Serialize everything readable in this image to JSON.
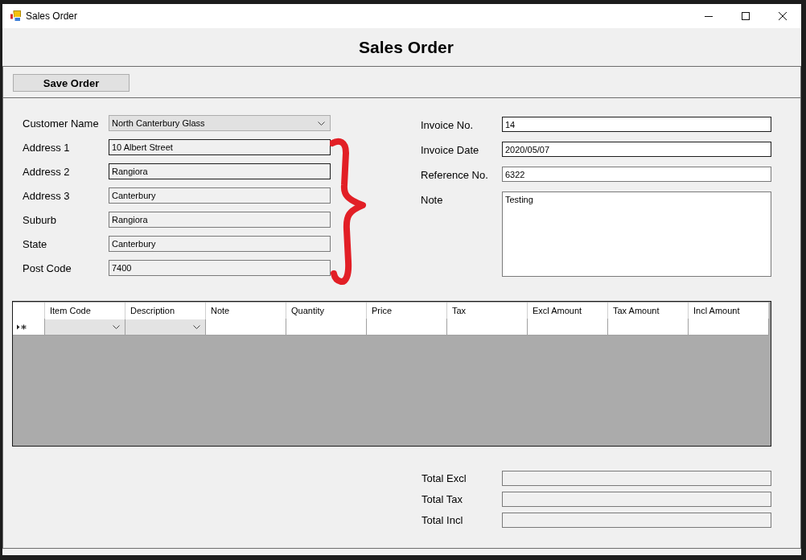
{
  "window": {
    "title": "Sales Order"
  },
  "heading": "Sales Order",
  "toolbar": {
    "buttons": [
      {
        "label": "Save Order"
      }
    ]
  },
  "customer": {
    "fields": [
      {
        "label": "Customer Name",
        "kind": "dropdown",
        "value": "North Canterbury Glass",
        "outlined": false,
        "readonly": true
      },
      {
        "label": "Address 1",
        "kind": "text",
        "value": "10 Albert Street",
        "outlined": true,
        "readonly": true
      },
      {
        "label": "Address 2",
        "kind": "text",
        "value": "Rangiora",
        "outlined": true,
        "readonly": true
      },
      {
        "label": "Address 3",
        "kind": "text",
        "value": "Canterbury",
        "outlined": false,
        "readonly": true
      },
      {
        "label": "Suburb",
        "kind": "text",
        "value": "Rangiora",
        "outlined": false,
        "readonly": true
      },
      {
        "label": "State",
        "kind": "text",
        "value": "Canterbury",
        "outlined": false,
        "readonly": true
      },
      {
        "label": "Post Code",
        "kind": "text",
        "value": "7400",
        "outlined": false,
        "readonly": true
      }
    ]
  },
  "invoice": {
    "fields": [
      {
        "label": "Invoice No.",
        "kind": "text",
        "value": "14",
        "outlined": true,
        "readonly": false
      },
      {
        "label": "Invoice Date",
        "kind": "text",
        "value": "2020/05/07",
        "outlined": true,
        "readonly": false
      },
      {
        "label": "Reference No.",
        "kind": "text",
        "value": "6322",
        "outlined": false,
        "readonly": false
      },
      {
        "label": "Note",
        "kind": "multiline",
        "value": "Testing",
        "outlined": false,
        "readonly": false
      }
    ]
  },
  "order_lines": {
    "columns": [
      {
        "label": "Item Code",
        "kind": "dropdown"
      },
      {
        "label": "Description",
        "kind": "dropdown"
      },
      {
        "label": "Note",
        "kind": "text"
      },
      {
        "label": "Quantity",
        "kind": "text"
      },
      {
        "label": "Price",
        "kind": "text"
      },
      {
        "label": "Tax",
        "kind": "text"
      },
      {
        "label": "Excl Amount",
        "kind": "text"
      },
      {
        "label": "Tax Amount",
        "kind": "text"
      },
      {
        "label": "Incl Amount",
        "kind": "text"
      }
    ],
    "new_row": {
      "current": true
    }
  },
  "totals": {
    "fields": [
      {
        "label": "Total Excl",
        "kind": "text",
        "outlined": false,
        "readonly": true
      },
      {
        "label": "Total Tax",
        "kind": "text",
        "outlined": false,
        "readonly": true
      },
      {
        "label": "Total Incl",
        "kind": "text",
        "outlined": false,
        "readonly": true
      }
    ]
  }
}
